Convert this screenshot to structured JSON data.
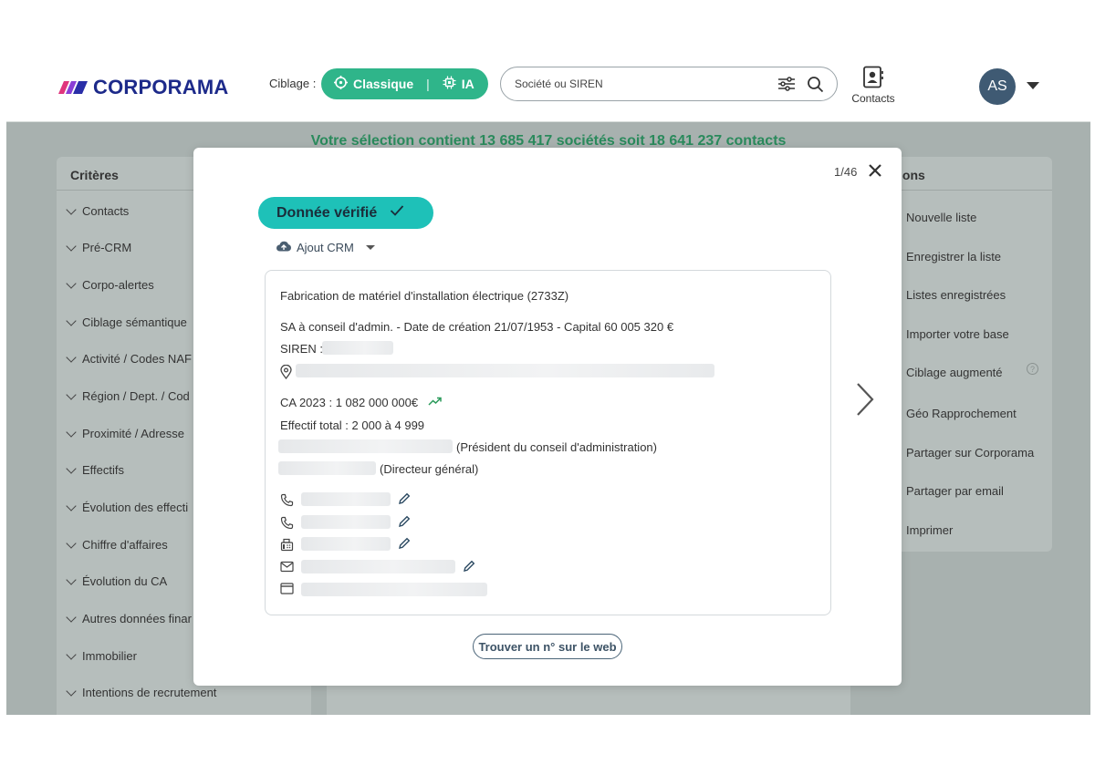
{
  "header": {
    "logo_text": "CORPORAMA",
    "ciblage_label": "Ciblage :",
    "mode_classique": "Classique",
    "mode_separator": "|",
    "mode_ia": "IA",
    "search_placeholder": "Société ou SIREN",
    "contacts_label": "Contacts",
    "avatar_initials": "AS"
  },
  "selection_summary": "Votre sélection contient 13 685 417 sociétés soit 18 641 237 contacts",
  "criteria": {
    "title": "Critères",
    "items": [
      "Contacts",
      "Pré-CRM",
      "Corpo-alertes",
      "Ciblage sémantique",
      "Activité / Codes NAF",
      "Région / Dept. / Cod",
      "Proximité / Adresse",
      "Effectifs",
      "Évolution des effecti",
      "Chiffre d'affaires",
      "Évolution du CA",
      "Autres données finar",
      "Immobilier",
      "Intentions de recrutement"
    ]
  },
  "actions": {
    "title": "ions",
    "items": [
      "Nouvelle liste",
      "Enregistrer la liste",
      "Listes enregistrées",
      "Importer votre base",
      "Ciblage augmenté",
      "Géo Rapprochement",
      "Partager sur Corporama",
      "Partager par email",
      "Imprimer"
    ],
    "help_symbol": "?"
  },
  "modal": {
    "pager": "1/46",
    "verified_label": "Donnée vérifié",
    "crm_label": "Ajout CRM",
    "activity": "Fabrication de matériel d'installation électrique (2733Z)",
    "legal_line": "SA à conseil d'admin.   -  Date de création 21/07/1953   -  Capital 60 005 320 €",
    "siren_label": "SIREN :",
    "revenue": "CA 2023 : 1 082 000 000€",
    "headcount": "Effectif total : 2 000 à 4 999",
    "role_1": "(Président du conseil d'administration)",
    "role_2": "(Directeur général)",
    "web_button": "Trouver un n° sur le web"
  },
  "colors": {
    "brand_green": "#2fb58a",
    "verified_teal": "#1ec1b8",
    "selection_text": "#2a8a5c",
    "avatar_bg": "#3f5a73"
  }
}
